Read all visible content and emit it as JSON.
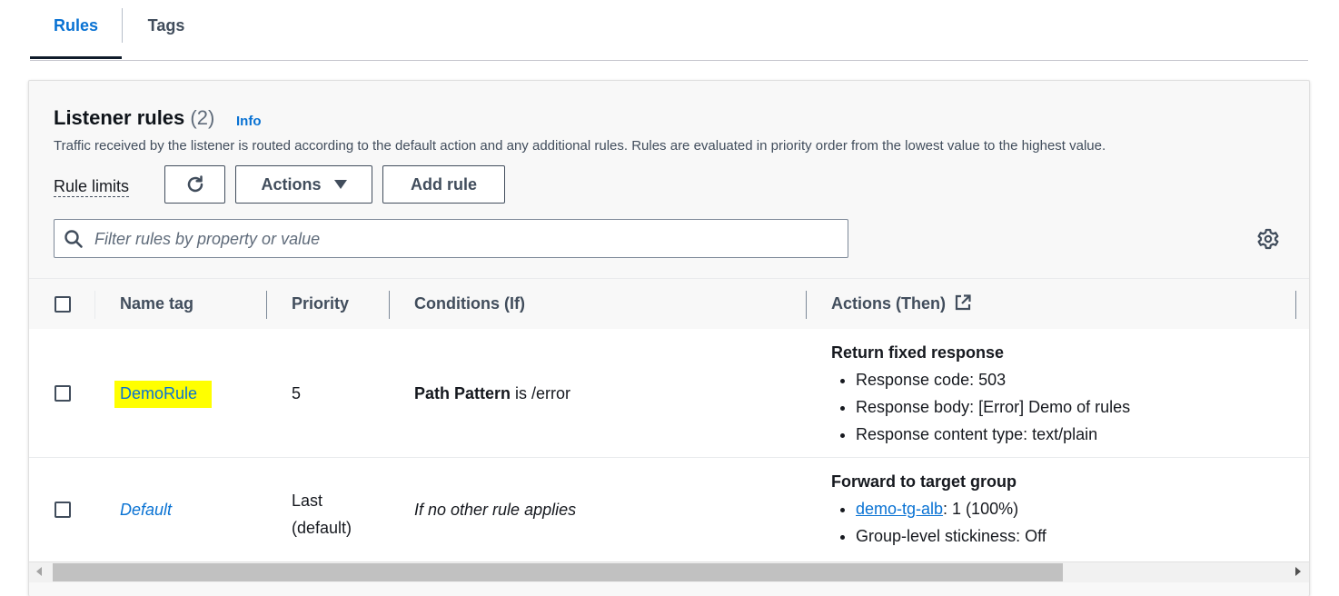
{
  "tabs": [
    {
      "label": "Rules"
    },
    {
      "label": "Tags"
    }
  ],
  "panel": {
    "title": "Listener rules",
    "count": "(2)",
    "info_link": "Info",
    "description": "Traffic received by the listener is routed according to the default action and any additional rules. Rules are evaluated in priority order from the lowest value to the highest value.",
    "rule_limits": "Rule limits",
    "actions_button": "Actions",
    "add_rule_button": "Add rule",
    "filter_placeholder": "Filter rules by property or value"
  },
  "table": {
    "headers": {
      "name_tag": "Name tag",
      "priority": "Priority",
      "conditions": "Conditions (If)",
      "actions": "Actions (Then)"
    },
    "rows": [
      {
        "name": "DemoRule",
        "priority": "5",
        "condition_bold": "Path Pattern",
        "condition_rest": " is /error",
        "action_title": "Return fixed response",
        "action_items": [
          "Response code: 503",
          "Response body: [Error] Demo of rules",
          "Response content type: text/plain"
        ]
      },
      {
        "name": "Default",
        "priority_line1": "Last",
        "priority_line2": "(default)",
        "condition": "If no other rule applies",
        "action_title": "Forward to target group",
        "target_group_link": "demo-tg-alb",
        "target_group_weight": ": 1 (100%)",
        "stickiness": "Group-level stickiness: Off"
      }
    ]
  },
  "colors": {
    "link": "#0972d3",
    "highlight": "#ffff00",
    "text": "#16191f"
  }
}
